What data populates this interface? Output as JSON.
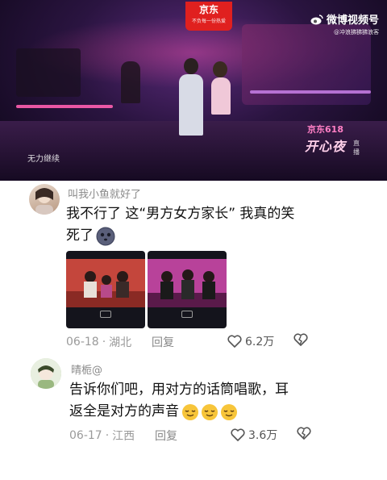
{
  "video": {
    "brand_badge_top": "京东",
    "brand_badge_bottom": "不负每一份热爱",
    "platform_name": "微博视频号",
    "platform_handle": "@冲浪狒狒狒浪客",
    "caption": "无力继续",
    "show_logo_line1": "京东618",
    "show_logo_line2": "开心夜",
    "show_logo_line3": "直播",
    "colors": {
      "badge": "#e0201f",
      "stage": "#2a1440",
      "accent": "#ff5fb0"
    }
  },
  "comments": [
    {
      "username": "叫我小鱼就好了",
      "text_line1": "我不行了 这“男方女方家长” 我真的笑",
      "text_line2": "死了",
      "emoji": "ghost-face-emoji",
      "images": [
        "image-1",
        "image-2"
      ],
      "date": "06-18",
      "separator": "·",
      "location": "湖北",
      "reply_label": "回复",
      "likes": "6.2万"
    },
    {
      "username": "晴栀@",
      "text_line1": "告诉你们吧，用对方的话筒唱歌，耳",
      "text_line2": "返全是对方的声音",
      "emoji": "relieved-face-emoji",
      "emoji_count": 3,
      "date": "06-17",
      "separator": "·",
      "location": "江西",
      "reply_label": "回复",
      "likes": "3.6万"
    }
  ]
}
